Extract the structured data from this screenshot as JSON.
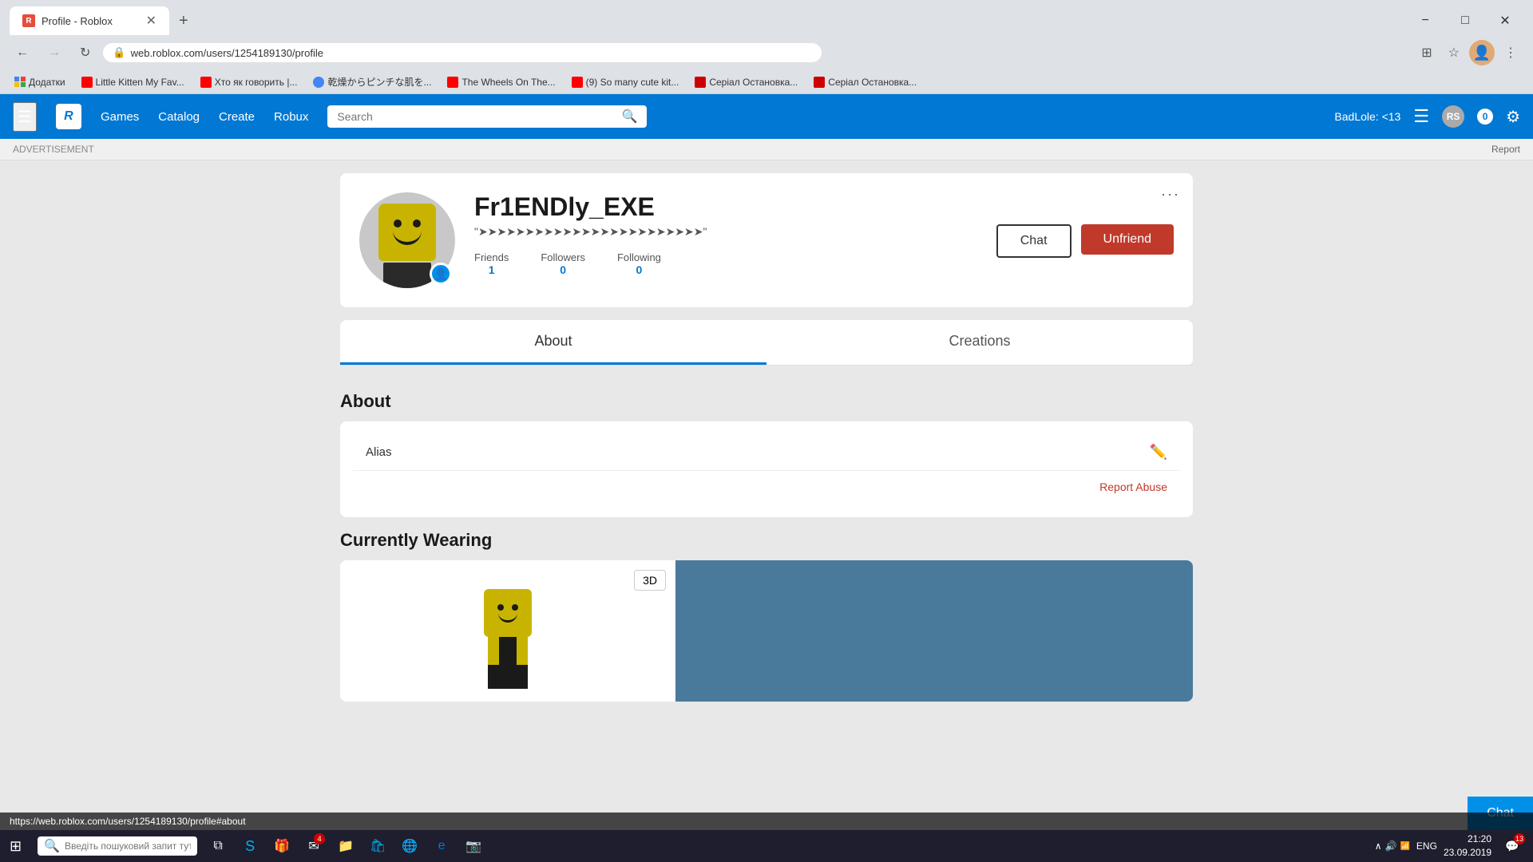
{
  "browser": {
    "tab_title": "Profile - Roblox",
    "tab_favicon": "R",
    "address": "web.roblox.com/users/1254189130/profile",
    "address_full": "https://web.roblox.com/users/1254189130/profile",
    "status_url": "https://web.roblox.com/users/1254189130/profile#about"
  },
  "bookmarks": [
    {
      "label": "Додатки",
      "icon_color": "#4285f4"
    },
    {
      "label": "Little Kitten My Fav...",
      "icon_color": "#ff0000"
    },
    {
      "label": "Хто як говорить |...",
      "icon_color": "#ff0000"
    },
    {
      "label": "乾燥からピンチな肌を...",
      "icon_color": "#4285f4"
    },
    {
      "label": "The Wheels On The...",
      "icon_color": "#ff0000"
    },
    {
      "label": "(9) So many cute kit...",
      "icon_color": "#ff0000"
    },
    {
      "label": "Серіал Остановка...",
      "icon_color": "#cc0000"
    },
    {
      "label": "Серіал Остановка...",
      "icon_color": "#cc0000"
    }
  ],
  "nav": {
    "games_label": "Games",
    "catalog_label": "Catalog",
    "create_label": "Create",
    "robux_label": "Robux",
    "search_placeholder": "Search",
    "username": "BadLole: <13",
    "notification_count": "0"
  },
  "ad_bar": {
    "label": "ADVERTISEMENT",
    "report_label": "Report"
  },
  "profile": {
    "username": "Fr1ENDly_EXE",
    "status": "\"➤➤➤➤➤➤➤➤➤➤➤➤➤➤➤➤➤➤➤➤➤➤➤➤\"",
    "friends_label": "Friends",
    "friends_count": "1",
    "followers_label": "Followers",
    "followers_count": "0",
    "following_label": "Following",
    "following_count": "0",
    "chat_btn": "Chat",
    "unfriend_btn": "Unfriend",
    "more_icon": "···"
  },
  "tabs": [
    {
      "label": "About",
      "active": true
    },
    {
      "label": "Creations",
      "active": false
    }
  ],
  "about": {
    "section_title": "About",
    "alias_label": "Alias",
    "report_abuse_label": "Report Abuse"
  },
  "wearing": {
    "section_title": "Currently Wearing",
    "btn_3d": "3D"
  },
  "chat_bubble": {
    "label": "Chat"
  },
  "taskbar": {
    "search_placeholder": "Введіть пошуковий запит тут",
    "time": "21:20",
    "date": "23.09.2019",
    "lang": "ENG",
    "notifications": "13"
  }
}
